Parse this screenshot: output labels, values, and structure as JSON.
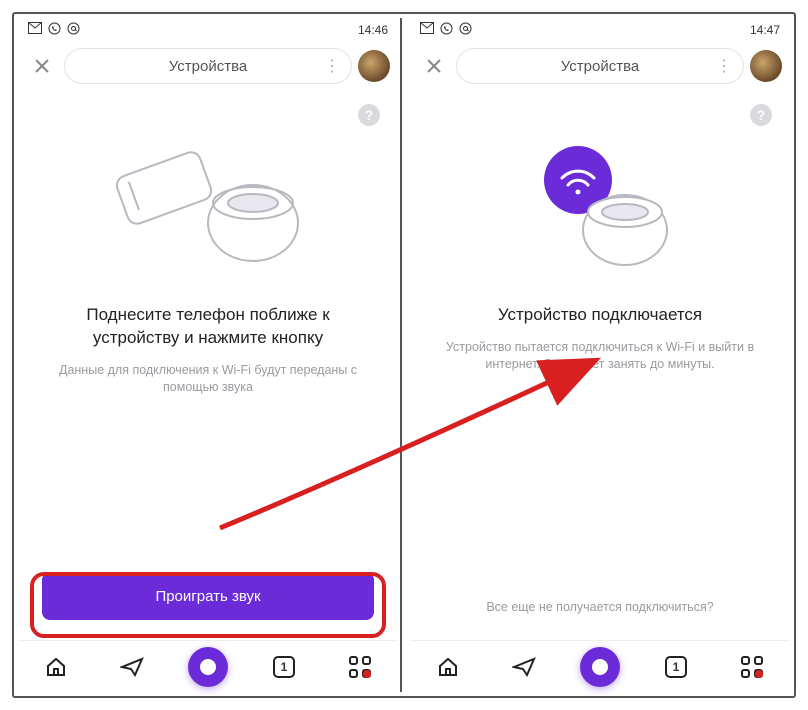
{
  "status": {
    "time_left": "14:46",
    "time_right": "14:47"
  },
  "header": {
    "title": "Устройства"
  },
  "left": {
    "heading": "Поднесите телефон поближе к устройству и нажмите кнопку",
    "subtext": "Данные для подключения к Wi-Fi будут переданы с помощью звука",
    "primary_button": "Проиграть звук"
  },
  "right": {
    "heading": "Устройство подключается",
    "subtext": "Устройство пытается подключиться к Wi-Fi и выйти в интернет. Это может занять до минуты.",
    "footer_link": "Все еще не получается подключиться?"
  },
  "nav": {
    "tabs_count": "1"
  },
  "colors": {
    "accent": "#6c2bd9",
    "highlight": "#d82020"
  }
}
